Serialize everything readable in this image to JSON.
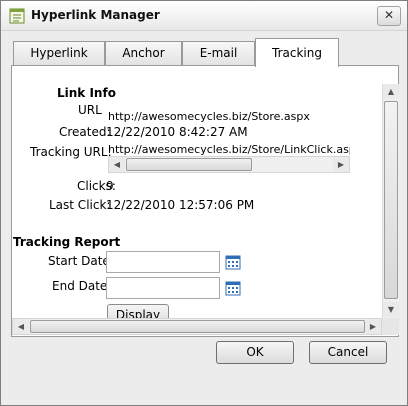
{
  "window": {
    "title": "Hyperlink Manager",
    "close_label": "✕"
  },
  "tabs": [
    {
      "label": "Hyperlink",
      "active": false
    },
    {
      "label": "Anchor",
      "active": false
    },
    {
      "label": "E-mail",
      "active": false
    },
    {
      "label": "Tracking",
      "active": true
    }
  ],
  "link_info": {
    "heading": "Link Info",
    "url_label": "URL",
    "url_value": "http://awesomecycles.biz/Store.aspx",
    "created_label": "Created:",
    "created_value": "12/22/2010 8:42:27 AM",
    "tracking_url_label": "Tracking URL:",
    "tracking_url_value": "http://awesomecycles.biz/Store/LinkClick.aspx",
    "clicks_label": "Clicks:",
    "clicks_value": "9",
    "last_click_label": "Last Click:",
    "last_click_value": "12/22/2010 12:57:06 PM"
  },
  "tracking_report": {
    "heading": "Tracking Report",
    "start_date_label": "Start Date:",
    "start_date_value": "",
    "end_date_label": "End Date:",
    "end_date_value": "",
    "display_label": "Display"
  },
  "footer": {
    "ok_label": "OK",
    "cancel_label": "Cancel"
  },
  "icons": {
    "title": "document-list-icon",
    "calendar": "calendar-icon",
    "close": "close-icon"
  },
  "colors": {
    "calendar_blue": "#2f6db5",
    "tab_active_bg": "#ffffff",
    "window_bg": "#ececec"
  }
}
